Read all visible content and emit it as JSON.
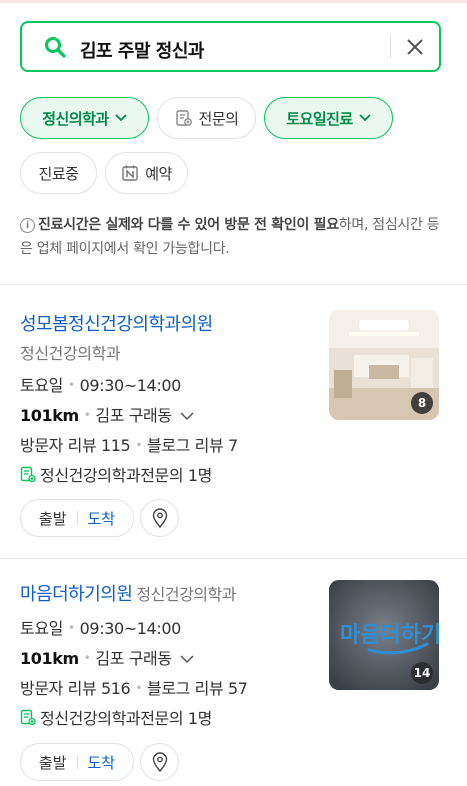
{
  "search": {
    "query": "김포 주말 정신과"
  },
  "filters": [
    {
      "label": "정신의학과",
      "active": true,
      "icon": "chevron-down-icon"
    },
    {
      "label": "전문의",
      "active": false,
      "icon": "doctor-badge-icon"
    },
    {
      "label": "토요일진료",
      "active": true,
      "icon": "chevron-down-icon"
    },
    {
      "label": "진료중",
      "active": false
    },
    {
      "label": "예약",
      "active": false,
      "icon": "naver-booking-icon"
    }
  ],
  "notice": {
    "bold": "진료시간은 실제와 다를 수 있어 방문 전 확인이 필요",
    "rest": "하며, 점심시간 등은 업체 페이지에서 확인 가능합니다."
  },
  "results": [
    {
      "name": "성모봄정신건강의학과의원",
      "category": "정신건강의학과",
      "day": "토요일",
      "hours": "09:30~14:00",
      "distance": "101km",
      "address": "김포 구래동",
      "visitor_reviews": "방문자 리뷰 115",
      "blog_reviews": "블로그 리뷰 7",
      "specialists": "정신건강의학과전문의 1명",
      "photo_count": "8",
      "depart": "출발",
      "arrive": "도착"
    },
    {
      "name": "마음더하기의원",
      "category": "정신건강의학과",
      "day": "토요일",
      "hours": "09:30~14:00",
      "distance": "101km",
      "address": "김포 구래동",
      "visitor_reviews": "방문자 리뷰 516",
      "blog_reviews": "블로그 리뷰 57",
      "specialists": "정신건강의학과전문의 1명",
      "photo_count": "14",
      "logo_text": "마음더하기",
      "depart": "출발",
      "arrive": "도착"
    }
  ],
  "colors": {
    "accent": "#03c75a",
    "link": "#0c60c9"
  }
}
